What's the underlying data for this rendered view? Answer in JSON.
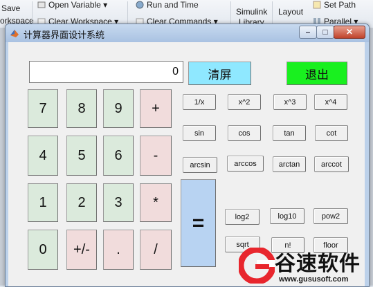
{
  "toolstrip": {
    "items": [
      {
        "label": "Save"
      },
      {
        "label": "orkspace"
      },
      {
        "label": "Open Variable ▾"
      },
      {
        "label": "Clear Workspace ▾"
      },
      {
        "label": "Run and Time"
      },
      {
        "label": "Clear Commands ▾"
      },
      {
        "label": "Simulink"
      },
      {
        "label": "Library"
      },
      {
        "label": "Layout"
      },
      {
        "label": "Set Path"
      },
      {
        "label": "Parallel ▾"
      }
    ]
  },
  "window": {
    "title": "计算器界面设计系统",
    "controls": {
      "minimize": "–",
      "maximize": "□",
      "close": "✕"
    }
  },
  "calculator": {
    "display_value": "0",
    "clear_label": "清屏",
    "quit_label": "退出",
    "keys": {
      "k7": "7",
      "k8": "8",
      "k9": "9",
      "plus": "+",
      "k4": "4",
      "k5": "5",
      "k6": "6",
      "minus": "-",
      "k1": "1",
      "k2": "2",
      "k3": "3",
      "times": "*",
      "k0": "0",
      "negate": "+/-",
      "dot": ".",
      "divide": "/",
      "equals": "="
    },
    "functions": {
      "reciprocal": "1/x",
      "square": "x^2",
      "cube": "x^3",
      "fourth": "x^4",
      "sin": "sin",
      "cos": "cos",
      "tan": "tan",
      "cot": "cot",
      "arcsin": "arcsin",
      "arccos": "arccos",
      "arctan": "arctan",
      "arccot": "arccot",
      "log2": "log2",
      "log10": "log10",
      "pow2": "pow2",
      "sqrt": "sqrt",
      "factorial": "n!",
      "floor": "floor"
    }
  },
  "watermark": {
    "name": "谷速软件",
    "url": "www.gususoft.com"
  },
  "colors": {
    "number_keys": "#dbeadc",
    "operator_keys": "#f1dcdc",
    "clear": "#8fe8ff",
    "quit": "#19f01f",
    "equals": "#b8d3f2"
  }
}
